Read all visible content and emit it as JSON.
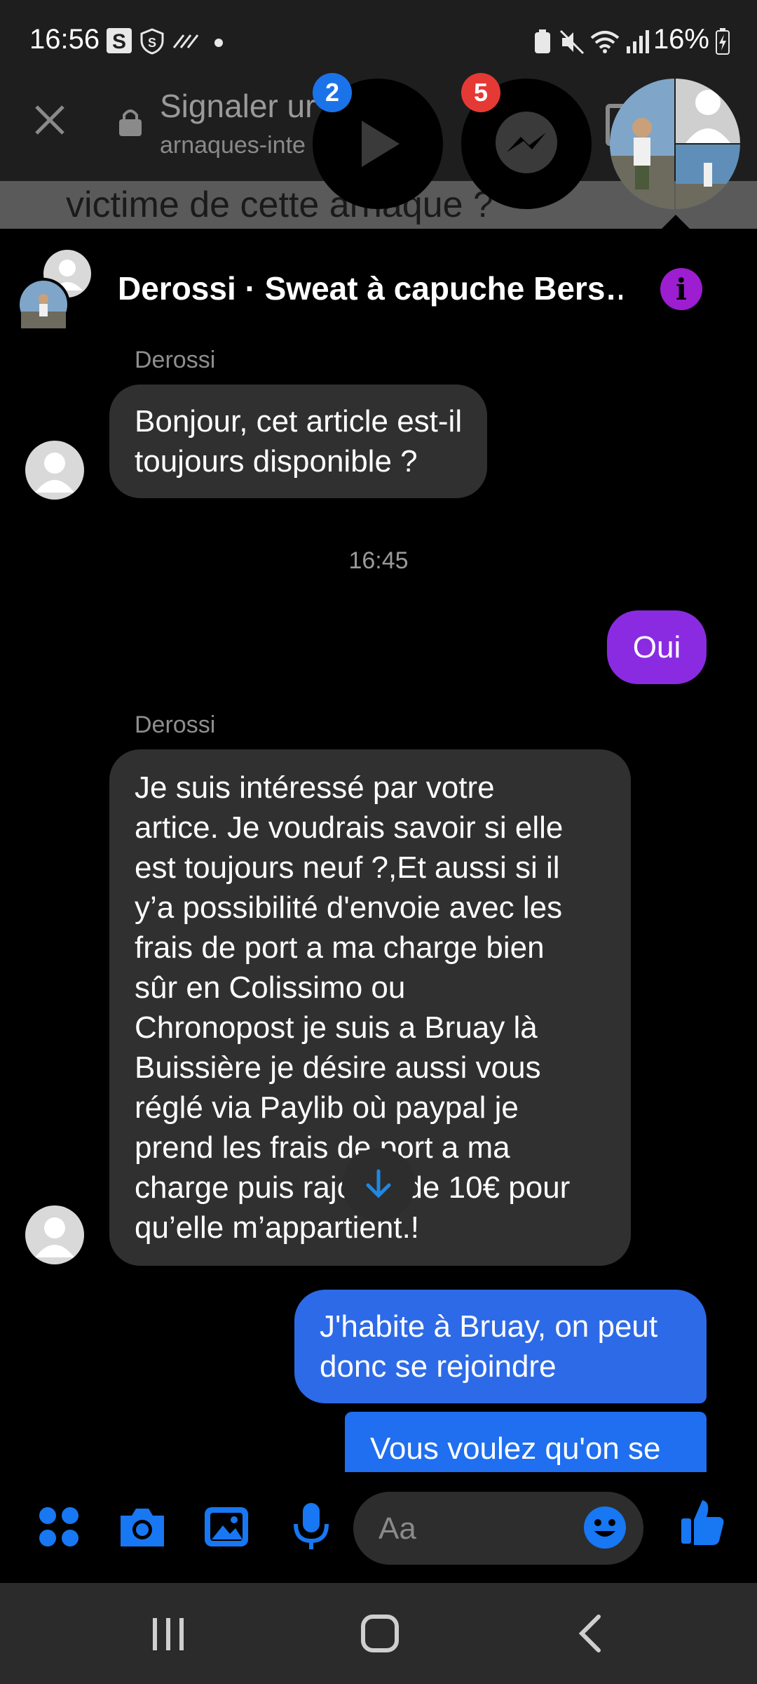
{
  "status_bar": {
    "time": "16:56",
    "battery": "16%"
  },
  "browser": {
    "title": "Signaler ur",
    "url": "arnaques-inte",
    "behind_text": "victime de cette arnaque ?"
  },
  "chat_heads": {
    "play_badge": "2",
    "messenger_badge": "5"
  },
  "conversation": {
    "title": "Derossi · Sweat à capuche Bers…",
    "messages": [
      {
        "sender": "Derossi",
        "text_lines": [
          "Bonjour, cet article est-il",
          "toujours disponible ?"
        ]
      },
      {
        "timestamp": "16:45"
      },
      {
        "text": "Oui"
      },
      {
        "sender": "Derossi",
        "text_lines": [
          "Je suis intéressé par votre",
          "artice. Je voudrais savoir si elle",
          "est toujours neuf ?,Et aussi si il",
          "y’a possibilité d'envoie avec les",
          "frais de port a ma charge bien",
          "sûr en Colissimo ou",
          "Chronopost je suis  a Bruay là",
          "Buissière je désire aussi vous",
          "réglé via Paylib où paypal je",
          "prend  les frais de port a ma",
          "charge puis rajoute de 10€ pour",
          "qu’elle m’appartient.!"
        ]
      },
      {
        "text_lines": [
          "J'habite à Bruay, on peut",
          "donc se rejoindre"
        ]
      },
      {
        "text": "Vous voulez qu'on se"
      }
    ]
  },
  "composer": {
    "placeholder": "Aa"
  },
  "colors": {
    "accent_purple": "#8a2be2",
    "accent_blue": "#2d6ae8",
    "icon_blue": "#1877f2",
    "incoming_bubble": "#303030"
  }
}
